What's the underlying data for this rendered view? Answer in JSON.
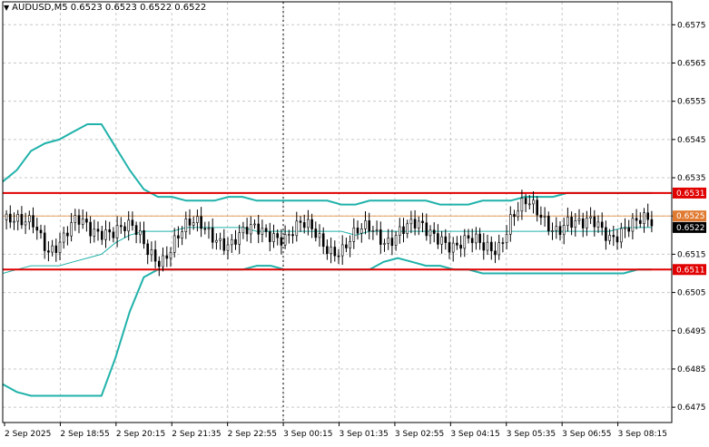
{
  "header": {
    "symbol_line": "AUDUSD,M5  0.6523 0.6523 0.6522 0.6522",
    "menu_icon": "triangle-down-icon"
  },
  "colors": {
    "background": "#ffffff",
    "grid": "#c8c8c8",
    "frame": "#000000",
    "candles": "#000000",
    "bollinger": "#20b2aa",
    "level_line": "#e00000",
    "level_label_bg": "#e00000",
    "bid_line": "#e8a060",
    "bid_label_bg": "#e07a30",
    "ask_label_bg": "#000000"
  },
  "price_axis": {
    "labels": [
      "0.6575",
      "0.6565",
      "0.6555",
      "0.6545",
      "0.6535",
      "0.6525",
      "0.6515",
      "0.6505",
      "0.6495",
      "0.6485",
      "0.6475"
    ]
  },
  "time_axis": {
    "labels": [
      "2 Sep 2025",
      "2 Sep 18:55",
      "2 Sep 20:15",
      "2 Sep 21:35",
      "2 Sep 22:55",
      "3 Sep 00:15",
      "3 Sep 01:35",
      "3 Sep 02:55",
      "3 Sep 04:15",
      "3 Sep 05:35",
      "3 Sep 06:55",
      "3 Sep 08:15"
    ]
  },
  "levels": {
    "resistance": "0.6531",
    "resistance_value": 0.6531,
    "support": "0.6511",
    "support_value": 0.6511,
    "bid": "0.6525",
    "bid_value": 0.6525,
    "current": "0.6522",
    "current_value": 0.6522
  },
  "chart_data": {
    "type": "candlestick",
    "symbol": "AUDUSD",
    "timeframe": "M5",
    "ohlc_current": {
      "open": 0.6523,
      "high": 0.6523,
      "low": 0.6522,
      "close": 0.6522
    },
    "ylim": [
      0.6471,
      0.6581
    ],
    "y_ticks": [
      0.6575,
      0.6565,
      0.6555,
      0.6545,
      0.6535,
      0.6525,
      0.6515,
      0.6505,
      0.6495,
      0.6485,
      0.6475
    ],
    "x_ticks": [
      "2 Sep 2025",
      "2 Sep 18:55",
      "2 Sep 20:15",
      "2 Sep 21:35",
      "2 Sep 22:55",
      "3 Sep 00:15",
      "3 Sep 01:35",
      "3 Sep 02:55",
      "3 Sep 04:15",
      "3 Sep 05:35",
      "3 Sep 06:55",
      "3 Sep 08:15"
    ],
    "horizontal_lines": [
      {
        "price": 0.6531,
        "color": "#e00000"
      },
      {
        "price": 0.6511,
        "color": "#e00000"
      },
      {
        "price": 0.6525,
        "color": "#e8a060"
      }
    ],
    "candle_close_path": [
      0.6524,
      0.6521,
      0.6523,
      0.6518,
      0.6519,
      0.6522,
      0.6521,
      0.6523,
      0.6522,
      0.652,
      0.6516,
      0.6515,
      0.6519,
      0.6521,
      0.6522,
      0.6521,
      0.6518,
      0.6519,
      0.6521,
      0.6522,
      0.652,
      0.6521,
      0.652,
      0.6518,
      0.6517,
      0.6519,
      0.6521,
      0.652,
      0.6522,
      0.6521,
      0.652,
      0.6521,
      0.6518,
      0.6517,
      0.6516,
      0.6518,
      0.6526,
      0.6527,
      0.6524,
      0.6523,
      0.6525,
      0.6521,
      0.6522,
      0.6521,
      0.6523,
      0.6522,
      0.6522
    ],
    "bollinger_upper": [
      0.6534,
      0.6537,
      0.6542,
      0.6544,
      0.6545,
      0.6547,
      0.6549,
      0.6549,
      0.6543,
      0.6537,
      0.6532,
      0.653,
      0.653,
      0.6529,
      0.6529,
      0.6529,
      0.653,
      0.653,
      0.6529,
      0.6529,
      0.6529,
      0.6529,
      0.6529,
      0.6529,
      0.6528,
      0.6528,
      0.6529,
      0.6529,
      0.6529,
      0.6529,
      0.6529,
      0.6528,
      0.6528,
      0.6528,
      0.6529,
      0.6529,
      0.6529,
      0.653,
      0.653,
      0.653,
      0.6531,
      0.6531,
      0.6531,
      0.6531,
      0.6531,
      0.6531,
      0.6531
    ],
    "bollinger_middle": [
      0.651,
      0.6511,
      0.6512,
      0.6512,
      0.6512,
      0.6513,
      0.6514,
      0.6515,
      0.6518,
      0.652,
      0.6521,
      0.6521,
      0.6521,
      0.6522,
      0.6522,
      0.6522,
      0.6522,
      0.6522,
      0.6521,
      0.6521,
      0.6521,
      0.6521,
      0.6521,
      0.6521,
      0.6521,
      0.652,
      0.6521,
      0.6521,
      0.6521,
      0.6521,
      0.6521,
      0.6521,
      0.6521,
      0.6521,
      0.6521,
      0.6521,
      0.6521,
      0.6521,
      0.6521,
      0.6521,
      0.6521,
      0.6521,
      0.6521,
      0.6521,
      0.6522,
      0.6522,
      0.6522
    ],
    "bollinger_lower": [
      0.6481,
      0.6479,
      0.6478,
      0.6478,
      0.6478,
      0.6478,
      0.6478,
      0.6478,
      0.6488,
      0.65,
      0.6509,
      0.6511,
      0.6511,
      0.6511,
      0.6511,
      0.6511,
      0.6511,
      0.6511,
      0.6512,
      0.6512,
      0.6511,
      0.6511,
      0.6511,
      0.6511,
      0.6511,
      0.6511,
      0.6511,
      0.6513,
      0.6514,
      0.6513,
      0.6512,
      0.6512,
      0.6511,
      0.6511,
      0.651,
      0.651,
      0.651,
      0.651,
      0.651,
      0.651,
      0.651,
      0.651,
      0.651,
      0.651,
      0.651,
      0.6511,
      0.6511
    ]
  }
}
